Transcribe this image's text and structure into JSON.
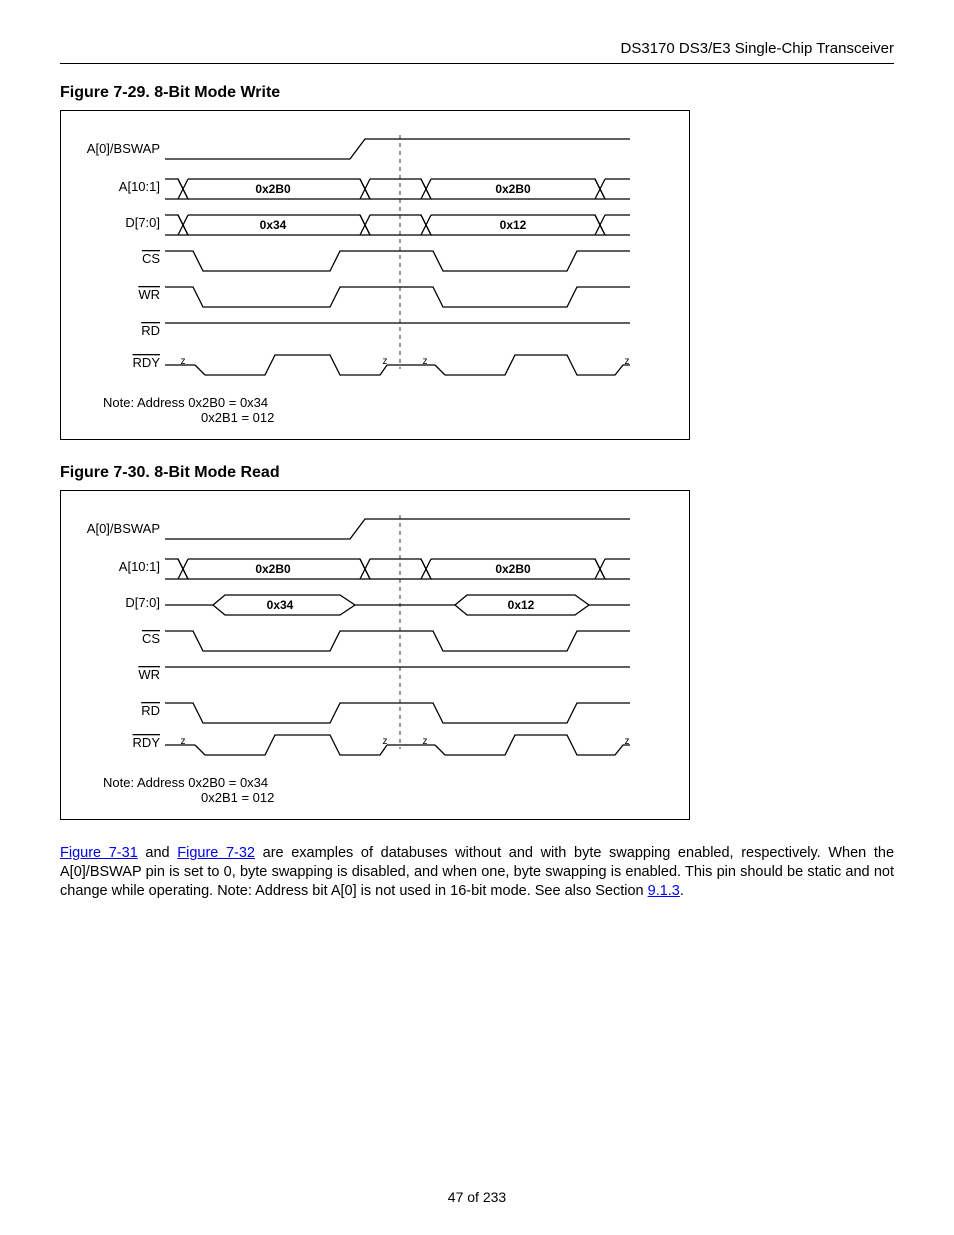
{
  "header": "DS3170 DS3/E3 Single-Chip Transceiver",
  "figure29": {
    "title": "Figure 7-29. 8-Bit Mode Write",
    "labels": {
      "a0": "A[0]/BSWAP",
      "addr": "A[10:1]",
      "data": "D[7:0]",
      "cs": "CS",
      "wr": "WR",
      "rd": "RD",
      "rdy": "RDY"
    },
    "values": {
      "addr1": "0x2B0",
      "addr2": "0x2B0",
      "data1": "0x34",
      "data2": "0x12",
      "z": "z"
    },
    "note1": "Note:  Address 0x2B0 = 0x34",
    "note2": "0x2B1 = 012"
  },
  "figure30": {
    "title": "Figure 7-30. 8-Bit Mode Read",
    "labels": {
      "a0": "A[0]/BSWAP",
      "addr": "A[10:1]",
      "data": "D[7:0]",
      "cs": "CS",
      "wr": "WR",
      "rd": "RD",
      "rdy": "RDY"
    },
    "values": {
      "addr1": "0x2B0",
      "addr2": "0x2B0",
      "data1": "0x34",
      "data2": "0x12",
      "z": "z"
    },
    "note1": "Note:  Address 0x2B0 = 0x34",
    "note2": "0x2B1 = 012"
  },
  "paragraph": {
    "link1": "Figure 7-31",
    "mid1": " and ",
    "link2": "Figure 7-32",
    "mid2": " are examples of databuses without and with byte swapping enabled, respectively. When the A[0]/BSWAP pin is set to 0, byte swapping is disabled, and when one, byte swapping is enabled. This pin should be static and not change while operating. Note: Address bit A[0] is not used in 16-bit mode. See also Section ",
    "link3": "9.1.3",
    "end": "."
  },
  "footer": "47 of 233"
}
